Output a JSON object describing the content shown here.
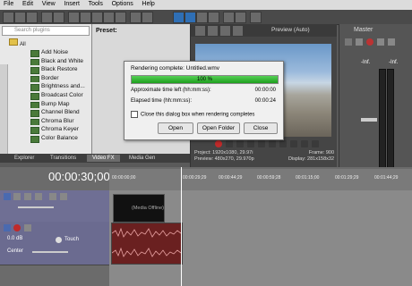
{
  "menu": [
    "File",
    "Edit",
    "View",
    "Insert",
    "Tools",
    "Options",
    "Help"
  ],
  "plugins": {
    "search_placeholder": "Search plugins",
    "root": "All",
    "items": [
      "Add Noise",
      "Black and White",
      "Black Restore",
      "Border",
      "Brightness and...",
      "Broadcast Color",
      "Bump Map",
      "Channel Blend",
      "Chroma Blur",
      "Chroma Keyer",
      "Color Balance"
    ]
  },
  "preset": {
    "label": "Preset:"
  },
  "tabs": [
    "Explorer",
    "Transitions",
    "Video FX",
    "Media Gen"
  ],
  "preview": {
    "dropdown": "Preview (Auto)",
    "info": {
      "project": "Project:  1920x1080, 29.97i",
      "preview": "Preview:  480x270, 29.970p",
      "frame": "Frame:      900",
      "display": "Display:  281x158x32"
    }
  },
  "master": {
    "label": "Master",
    "left_db": "-Inf.",
    "right_db": "-Inf."
  },
  "dialog": {
    "title": "Rendering complete: Untitled.wmv",
    "progress": 100,
    "progress_label": "100 %",
    "approx_label": "Approximate time left (hh:mm:ss):",
    "approx_value": "00:00:00",
    "elapsed_label": "Elapsed time (hh:mm:ss):",
    "elapsed_value": "00:00:24",
    "close_checkbox_label": "Close this dialog box when rendering completes",
    "buttons": {
      "open": "Open",
      "open_folder": "Open Folder",
      "close": "Close"
    }
  },
  "timeline": {
    "timecode": "00:00:30;00",
    "ticks": [
      "00:00:00;00",
      "00:00:29;29",
      "00:00:44;29",
      "00:00:59;28",
      "00:01:15;00",
      "00:01:29;29",
      "00:01:44;29"
    ],
    "video_clip_label": "(Media Offline)",
    "audio_track": {
      "level": "0.0 dB",
      "pan": "Center",
      "mode": "Touch"
    }
  }
}
